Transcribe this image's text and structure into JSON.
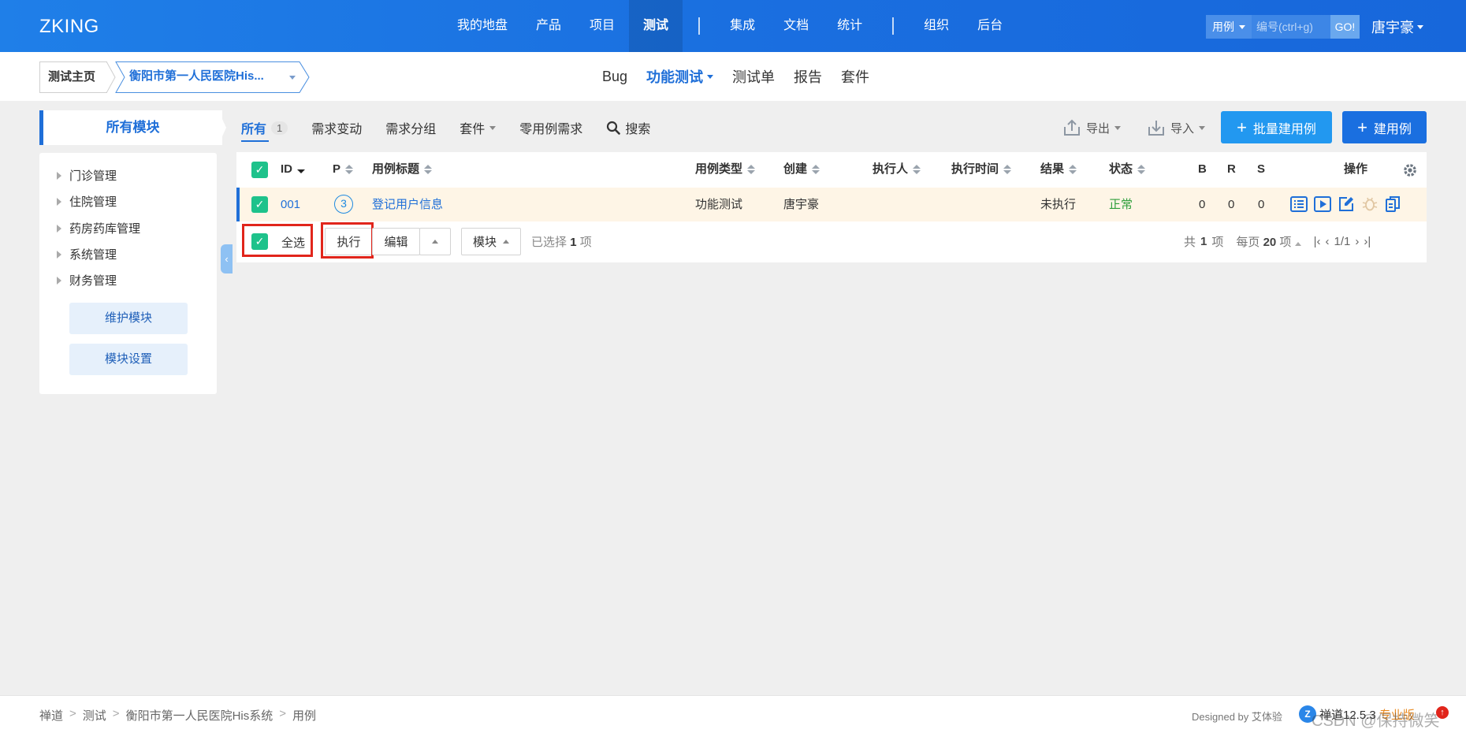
{
  "header": {
    "brand": "ZKING",
    "nav": [
      {
        "label": "我的地盘"
      },
      {
        "label": "产品"
      },
      {
        "label": "项目"
      },
      {
        "label": "测试",
        "active": true
      },
      {
        "label": "集成"
      },
      {
        "label": "文档"
      },
      {
        "label": "统计"
      },
      {
        "label": "组织"
      },
      {
        "label": "后台"
      }
    ],
    "search_type": "用例",
    "search_placeholder": "编号(ctrl+g)",
    "go_label": "GO!",
    "user": "唐宇豪"
  },
  "subheader": {
    "home_crumb": "测试主页",
    "product_crumb": "衡阳市第一人民医院His...",
    "nav": [
      {
        "label": "Bug"
      },
      {
        "label": "功能测试",
        "active": true
      },
      {
        "label": "测试单"
      },
      {
        "label": "报告"
      },
      {
        "label": "套件"
      }
    ]
  },
  "sidebar": {
    "title": "所有模块",
    "modules": [
      "门诊管理",
      "住院管理",
      "药房药库管理",
      "系统管理",
      "财务管理"
    ],
    "maintain_button": "维护模块",
    "settings_button": "模块设置"
  },
  "toolbar": {
    "tabs": [
      {
        "label": "所有",
        "count": "1",
        "active": true
      },
      {
        "label": "需求变动"
      },
      {
        "label": "需求分组"
      },
      {
        "label": "套件",
        "dropdown": true
      },
      {
        "label": "零用例需求"
      }
    ],
    "search_label": "搜索",
    "export_label": "导出",
    "import_label": "导入",
    "batch_create_label": "批量建用例",
    "create_label": "建用例",
    "colors": {
      "batch": "#2298f0",
      "create": "#1a6fe0"
    }
  },
  "table": {
    "headers": {
      "id": "ID",
      "pri": "P",
      "title": "用例标题",
      "type": "用例类型",
      "creator": "创建",
      "executor": "执行人",
      "exec_time": "执行时间",
      "result": "结果",
      "status": "状态",
      "b": "B",
      "r": "R",
      "s": "S",
      "actions": "操作"
    },
    "rows": [
      {
        "id": "001",
        "pri": "3",
        "title": "登记用户信息",
        "type": "功能测试",
        "creator": "唐宇豪",
        "executor": "",
        "exec_time": "",
        "result": "未执行",
        "status": "正常",
        "b": "0",
        "r": "0",
        "s": "0"
      }
    ]
  },
  "footer": {
    "select_all": "全选",
    "execute_label": "执行",
    "edit_label": "编辑",
    "module_label": "模块",
    "selected_prefix": "已选择",
    "selected_count": "1",
    "selected_suffix": "项",
    "total_prefix": "共",
    "total_count": "1",
    "total_suffix": "项",
    "per_page_prefix": "每页",
    "per_page": "20",
    "per_page_suffix": "项",
    "page": "1/1"
  },
  "bottombar": {
    "breadcrumb": [
      "禅道",
      "测试",
      "衡阳市第一人民医院His系统",
      "用例"
    ],
    "designed_by": "Designed by 艾体验",
    "version": "禅道12.5.3",
    "edition": "专业版",
    "watermark": "CSDN @保持微笑"
  }
}
